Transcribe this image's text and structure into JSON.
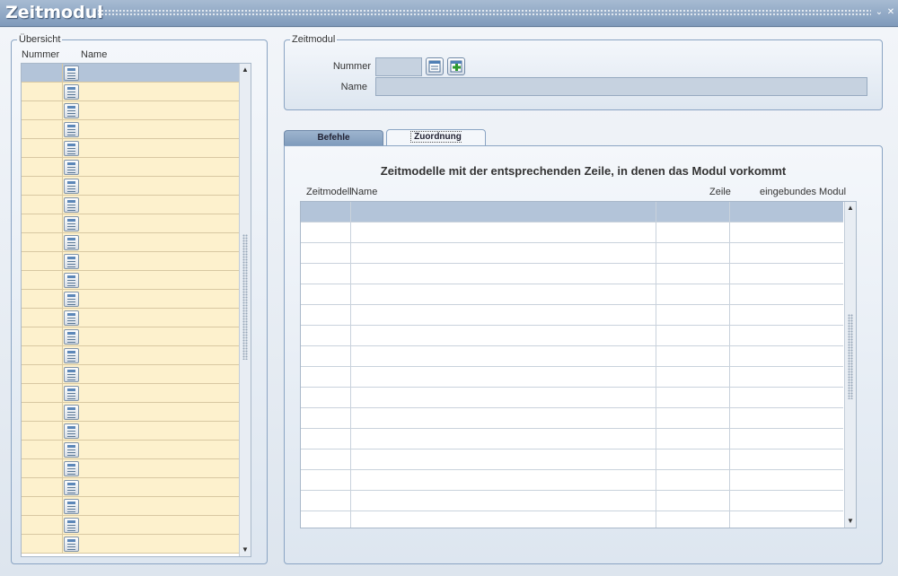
{
  "window": {
    "title": "Zeitmodul",
    "minimize_glyph": "⌄",
    "close_glyph": "✕"
  },
  "overview": {
    "legend": "Übersicht",
    "columns": [
      "Nummer",
      "Name"
    ],
    "row_count": 26,
    "row_color": "#fdf1cd",
    "header_row_color": "#b3c4d9"
  },
  "zeitmodul_panel": {
    "legend": "Zeitmodul",
    "nummer_label": "Nummer",
    "name_label": "Name",
    "nummer_value": "",
    "name_value": "",
    "search_icon": "list-search-icon",
    "add_icon": "add-plus-icon"
  },
  "tabs": [
    {
      "label": "Befehle",
      "active": false
    },
    {
      "label": "Zuordnung Zeitmodell",
      "active": true
    }
  ],
  "assignment": {
    "heading": "Zeitmodelle mit der entsprechenden Zeile, in denen das Modul vorkommt",
    "columns": [
      "Zeitmodell",
      "Name",
      "Zeile",
      "eingebundes Modul"
    ],
    "row_count": 15
  },
  "colors": {
    "titlebar": "#8ea7c6",
    "accent_green": "#2e9a2e"
  }
}
